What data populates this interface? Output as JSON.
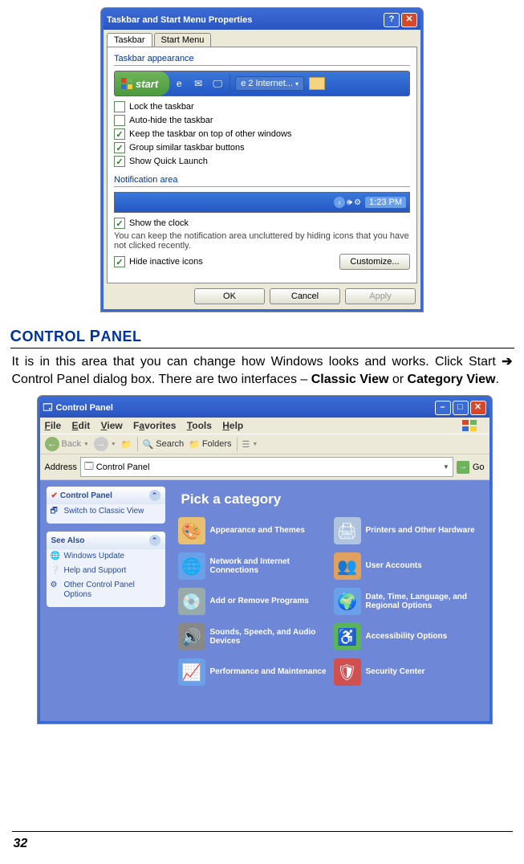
{
  "dialog1": {
    "title": "Taskbar and Start Menu Properties",
    "tabs": [
      "Taskbar",
      "Start Menu"
    ],
    "group1_title": "Taskbar appearance",
    "start_label": "start",
    "tb_app_label": "2 Internet...",
    "checks1": [
      {
        "label": "Lock the taskbar",
        "checked": false,
        "u": "L"
      },
      {
        "label": "Auto-hide the taskbar",
        "checked": false,
        "u": "A"
      },
      {
        "label": "Keep the taskbar on top of other windows",
        "checked": true,
        "u": "K"
      },
      {
        "label": "Group similar taskbar buttons",
        "checked": true,
        "u": "G"
      },
      {
        "label": "Show Quick Launch",
        "checked": true,
        "u": "Q"
      }
    ],
    "group2_title": "Notification area",
    "notif_time": "1:23 PM",
    "show_clock": {
      "label": "Show the clock",
      "checked": true
    },
    "help_text": "You can keep the notification area uncluttered by hiding icons that you have not clicked recently.",
    "hide_inactive": {
      "label": "Hide inactive icons",
      "checked": true
    },
    "customize_btn": "Customize...",
    "buttons": {
      "ok": "OK",
      "cancel": "Cancel",
      "apply": "Apply"
    }
  },
  "article": {
    "heading_1": "C",
    "heading_2": "ONTROL ",
    "heading_3": "P",
    "heading_4": "ANEL",
    "p1a": "It is in this area that you can change how Windows looks and works. Click Start ",
    "p1b": " Control Panel dialog box. There are two interfaces – ",
    "classic": "Classic View",
    "or": " or ",
    "category": "Category View",
    "period": "."
  },
  "cp": {
    "title": "Control Panel",
    "menu": [
      "File",
      "Edit",
      "View",
      "Favorites",
      "Tools",
      "Help"
    ],
    "toolbar": {
      "back": "Back",
      "search": "Search",
      "folders": "Folders"
    },
    "address_label": "Address",
    "address_value": "Control Panel",
    "go": "Go",
    "side1_title": "Control Panel",
    "side1_item": "Switch to Classic View",
    "side2_title": "See Also",
    "side2_items": [
      "Windows Update",
      "Help and Support",
      "Other Control Panel Options"
    ],
    "main_heading": "Pick a category",
    "cats": [
      {
        "label": "Appearance and Themes",
        "color": "#e8c070"
      },
      {
        "label": "Printers and Other Hardware",
        "color": "#b0c4de"
      },
      {
        "label": "Network and Internet Connections",
        "color": "#6aa0e8"
      },
      {
        "label": "User Accounts",
        "color": "#e0a060"
      },
      {
        "label": "Add or Remove Programs",
        "color": "#9aa"
      },
      {
        "label": "Date, Time, Language, and Regional Options",
        "color": "#6aa0e8"
      },
      {
        "label": "Sounds, Speech, and Audio Devices",
        "color": "#888"
      },
      {
        "label": "Accessibility Options",
        "color": "#5ab45a"
      },
      {
        "label": "Performance and Maintenance",
        "color": "#6aa0e8"
      },
      {
        "label": "Security Center",
        "color": "#d05050"
      }
    ]
  },
  "page_number": "32"
}
